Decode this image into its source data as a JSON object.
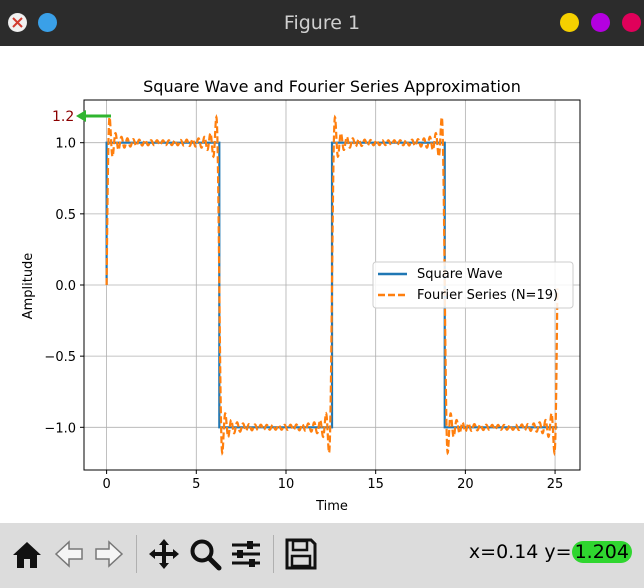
{
  "window": {
    "title": "Figure 1",
    "left_icons": [
      {
        "name": "app-icon",
        "color": "#e8e8e8"
      },
      {
        "name": "app-icon-blue",
        "color": "#3aa0e8"
      }
    ],
    "right_buttons": [
      {
        "name": "minimize-button",
        "color": "#f5d000"
      },
      {
        "name": "maximize-button",
        "color": "#b400e0"
      },
      {
        "name": "close-button",
        "color": "#e0005a"
      }
    ]
  },
  "toolbar": {
    "tools": [
      "home-icon",
      "back-arrow-icon",
      "forward-arrow-icon",
      "pan-icon",
      "zoom-icon",
      "configure-subplots-icon",
      "save-icon"
    ],
    "coord_x_label": "x=0.14 y=",
    "coord_y_value": "1.204"
  },
  "chart_data": {
    "type": "line",
    "title": "Square Wave and Fourier Series Approximation",
    "xlabel": "Time",
    "ylabel": "Amplitude",
    "xlim": [
      -1.26,
      26.39
    ],
    "ylim": [
      -1.3,
      1.3
    ],
    "xticks": [
      0,
      5,
      10,
      15,
      20,
      25
    ],
    "xtick_labels": [
      "0",
      "5",
      "10",
      "15",
      "20",
      "25"
    ],
    "yticks": [
      -1.0,
      -0.5,
      0.0,
      0.5,
      1.0
    ],
    "ytick_labels": [
      "−1.0",
      "−0.5",
      "0.0",
      "0.5",
      "1.0"
    ],
    "grid": true,
    "legend_position": "center-right",
    "x_range": [
      0,
      25.13
    ],
    "series": [
      {
        "name": "Square Wave",
        "color": "#1f77b4",
        "style": "solid",
        "period": 12.566,
        "amplitude": 1
      },
      {
        "name": "Fourier Series (N=19)",
        "color": "#ff7f0e",
        "style": "dashed",
        "harmonics": 19,
        "amplitude": 1
      }
    ],
    "annotation": {
      "text": "1.2",
      "color": "#8b0000",
      "arrow_color": "#2fb52f"
    }
  }
}
